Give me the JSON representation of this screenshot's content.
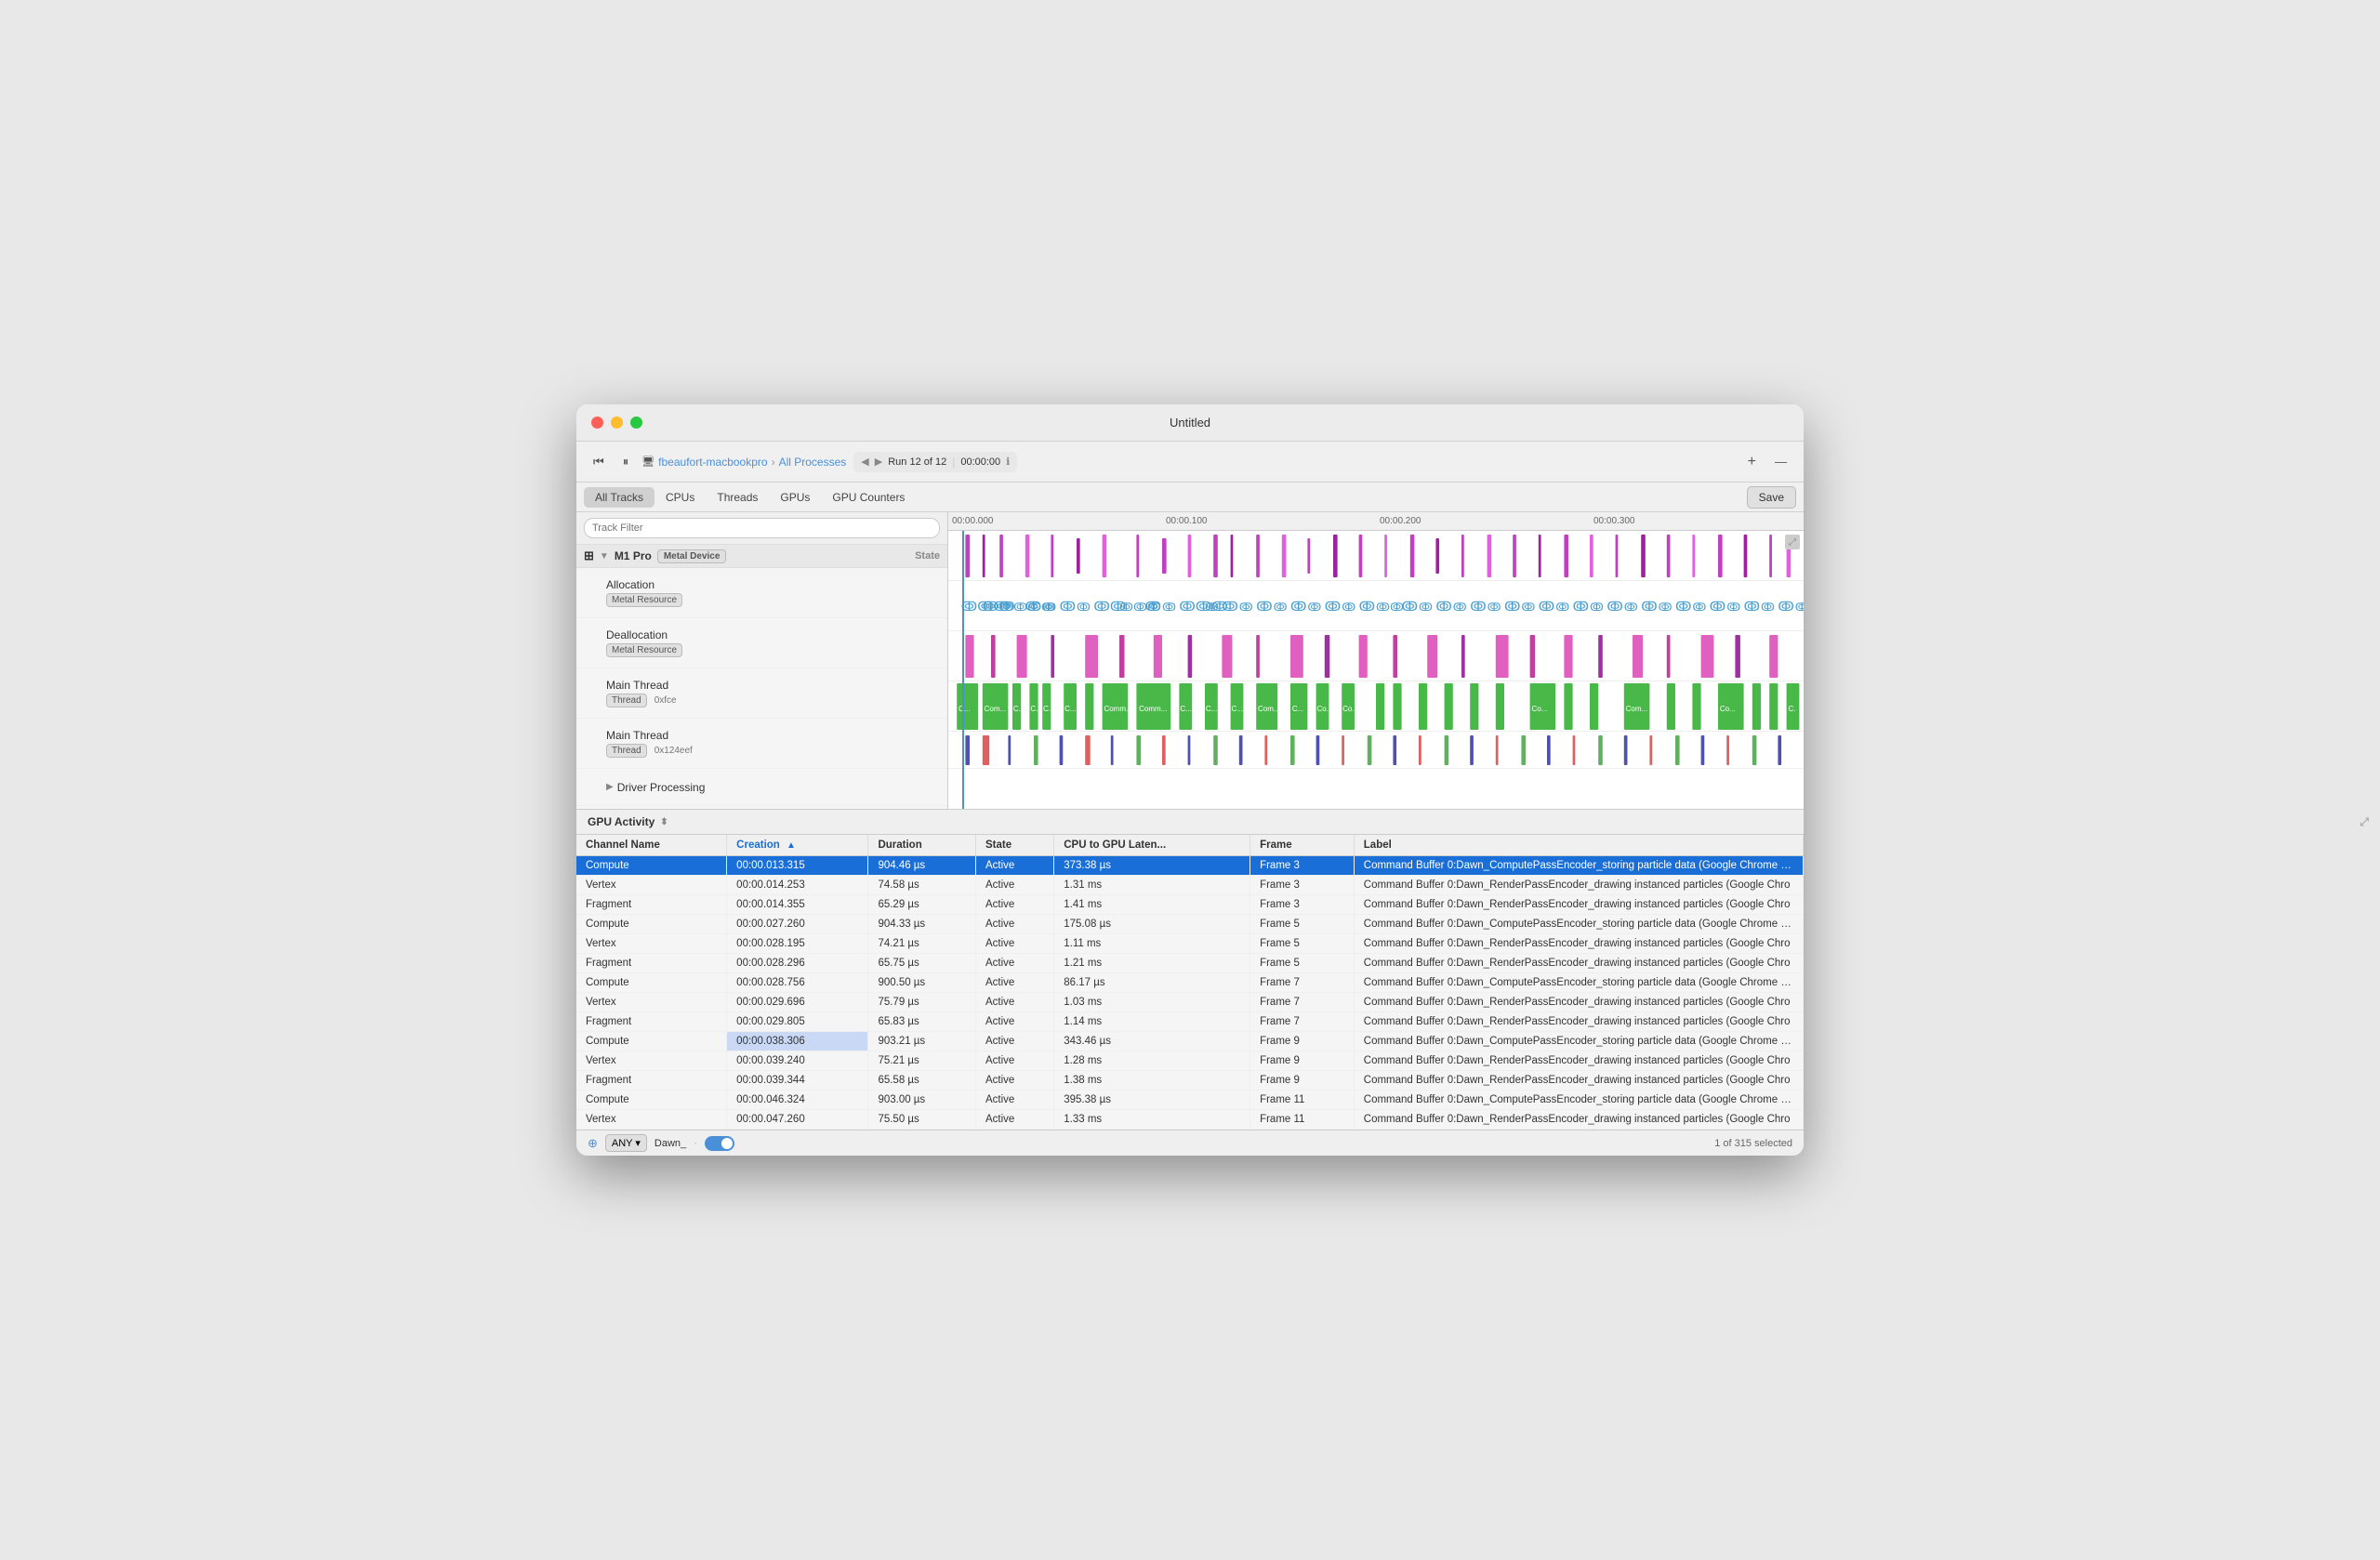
{
  "window": {
    "title": "Untitled"
  },
  "toolbar": {
    "breadcrumb_device": "fbeaufort-macbookpro",
    "breadcrumb_process": "All Processes",
    "run_label": "Run 12 of 12",
    "run_time": "00:00:00",
    "add_label": "+",
    "minimize_label": "—"
  },
  "nav": {
    "tabs": [
      "All Tracks",
      "CPUs",
      "Threads",
      "GPUs",
      "GPU Counters"
    ],
    "active_tab": "All Tracks",
    "save_label": "Save"
  },
  "timeline": {
    "filter_placeholder": "Track Filter",
    "ruler_marks": [
      "00:00.000",
      "00:00.100",
      "00:00.200",
      "00:00.300"
    ],
    "group_name": "M1 Pro",
    "group_badge": "Metal Device",
    "state_col": "State",
    "tracks": [
      {
        "name": "Allocation",
        "badge": "Metal Resource",
        "type": "alloc"
      },
      {
        "name": "Deallocation",
        "badge": "Metal Resource",
        "type": "dealloc"
      },
      {
        "name": "Main Thread",
        "badge": "Thread",
        "addr": "0xfce",
        "type": "thread_main1"
      },
      {
        "name": "Main Thread",
        "badge": "Thread",
        "addr": "0x124eef",
        "type": "thread_main2"
      },
      {
        "name": "Driver Processing",
        "expandable": true,
        "type": "driver"
      }
    ]
  },
  "gpu_activity": {
    "title": "GPU Activity",
    "columns": [
      {
        "key": "channel",
        "label": "Channel Name"
      },
      {
        "key": "creation",
        "label": "Creation",
        "sorted": true,
        "sort_dir": "asc"
      },
      {
        "key": "duration",
        "label": "Duration"
      },
      {
        "key": "state",
        "label": "State"
      },
      {
        "key": "cpu_gpu_lat",
        "label": "CPU to GPU Laten..."
      },
      {
        "key": "frame",
        "label": "Frame"
      },
      {
        "key": "label",
        "label": "Label"
      }
    ],
    "rows": [
      {
        "channel": "Compute",
        "creation": "00:00.013.315",
        "duration": "904.46 µs",
        "state": "Active",
        "cpu_gpu_lat": "373.38 µs",
        "frame": "Frame 3",
        "label": "Command Buffer 0:Dawn_ComputePassEncoder_storing particle data   (Google Chrome He",
        "selected": true,
        "highlight_creation": false
      },
      {
        "channel": "Vertex",
        "creation": "00:00.014.253",
        "duration": "74.58 µs",
        "state": "Active",
        "cpu_gpu_lat": "1.31 ms",
        "frame": "Frame 3",
        "label": "Command Buffer 0:Dawn_RenderPassEncoder_drawing instanced particles   (Google Chro",
        "selected": false
      },
      {
        "channel": "Fragment",
        "creation": "00:00.014.355",
        "duration": "65.29 µs",
        "state": "Active",
        "cpu_gpu_lat": "1.41 ms",
        "frame": "Frame 3",
        "label": "Command Buffer 0:Dawn_RenderPassEncoder_drawing instanced particles   (Google Chro",
        "selected": false
      },
      {
        "channel": "Compute",
        "creation": "00:00.027.260",
        "duration": "904.33 µs",
        "state": "Active",
        "cpu_gpu_lat": "175.08 µs",
        "frame": "Frame 5",
        "label": "Command Buffer 0:Dawn_ComputePassEncoder_storing particle data   (Google Chrome He",
        "selected": false
      },
      {
        "channel": "Vertex",
        "creation": "00:00.028.195",
        "duration": "74.21 µs",
        "state": "Active",
        "cpu_gpu_lat": "1.11 ms",
        "frame": "Frame 5",
        "label": "Command Buffer 0:Dawn_RenderPassEncoder_drawing instanced particles   (Google Chro",
        "selected": false
      },
      {
        "channel": "Fragment",
        "creation": "00:00.028.296",
        "duration": "65.75 µs",
        "state": "Active",
        "cpu_gpu_lat": "1.21 ms",
        "frame": "Frame 5",
        "label": "Command Buffer 0:Dawn_RenderPassEncoder_drawing instanced particles   (Google Chro",
        "selected": false
      },
      {
        "channel": "Compute",
        "creation": "00:00.028.756",
        "duration": "900.50 µs",
        "state": "Active",
        "cpu_gpu_lat": "86.17 µs",
        "frame": "Frame 7",
        "label": "Command Buffer 0:Dawn_ComputePassEncoder_storing particle data   (Google Chrome He",
        "selected": false
      },
      {
        "channel": "Vertex",
        "creation": "00:00.029.696",
        "duration": "75.79 µs",
        "state": "Active",
        "cpu_gpu_lat": "1.03 ms",
        "frame": "Frame 7",
        "label": "Command Buffer 0:Dawn_RenderPassEncoder_drawing instanced particles   (Google Chro",
        "selected": false
      },
      {
        "channel": "Fragment",
        "creation": "00:00.029.805",
        "duration": "65.83 µs",
        "state": "Active",
        "cpu_gpu_lat": "1.14 ms",
        "frame": "Frame 7",
        "label": "Command Buffer 0:Dawn_RenderPassEncoder_drawing instanced particles   (Google Chro",
        "selected": false
      },
      {
        "channel": "Compute",
        "creation": "00:00.038.306",
        "duration": "903.21 µs",
        "state": "Active",
        "cpu_gpu_lat": "343.46 µs",
        "frame": "Frame 9",
        "label": "Command Buffer 0:Dawn_ComputePassEncoder_storing particle data   (Google Chrome He",
        "selected": false,
        "highlight_creation": true
      },
      {
        "channel": "Vertex",
        "creation": "00:00.039.240",
        "duration": "75.21 µs",
        "state": "Active",
        "cpu_gpu_lat": "1.28 ms",
        "frame": "Frame 9",
        "label": "Command Buffer 0:Dawn_RenderPassEncoder_drawing instanced particles   (Google Chro",
        "selected": false
      },
      {
        "channel": "Fragment",
        "creation": "00:00.039.344",
        "duration": "65.58 µs",
        "state": "Active",
        "cpu_gpu_lat": "1.38 ms",
        "frame": "Frame 9",
        "label": "Command Buffer 0:Dawn_RenderPassEncoder_drawing instanced particles   (Google Chro",
        "selected": false
      },
      {
        "channel": "Compute",
        "creation": "00:00.046.324",
        "duration": "903.00 µs",
        "state": "Active",
        "cpu_gpu_lat": "395.38 µs",
        "frame": "Frame 11",
        "label": "Command Buffer 0:Dawn_ComputePassEncoder_storing particle data   (Google Chrome He",
        "selected": false
      },
      {
        "channel": "Vertex",
        "creation": "00:00.047.260",
        "duration": "75.50 µs",
        "state": "Active",
        "cpu_gpu_lat": "1.33 ms",
        "frame": "Frame 11",
        "label": "Command Buffer 0:Dawn_RenderPassEncoder_drawing instanced particles   (Google Chro",
        "selected": false
      }
    ]
  },
  "status_bar": {
    "filter_icon_label": "⊕",
    "filter_any": "ANY",
    "filter_value": "Dawn_",
    "selection_info": "1 of 315 selected"
  }
}
